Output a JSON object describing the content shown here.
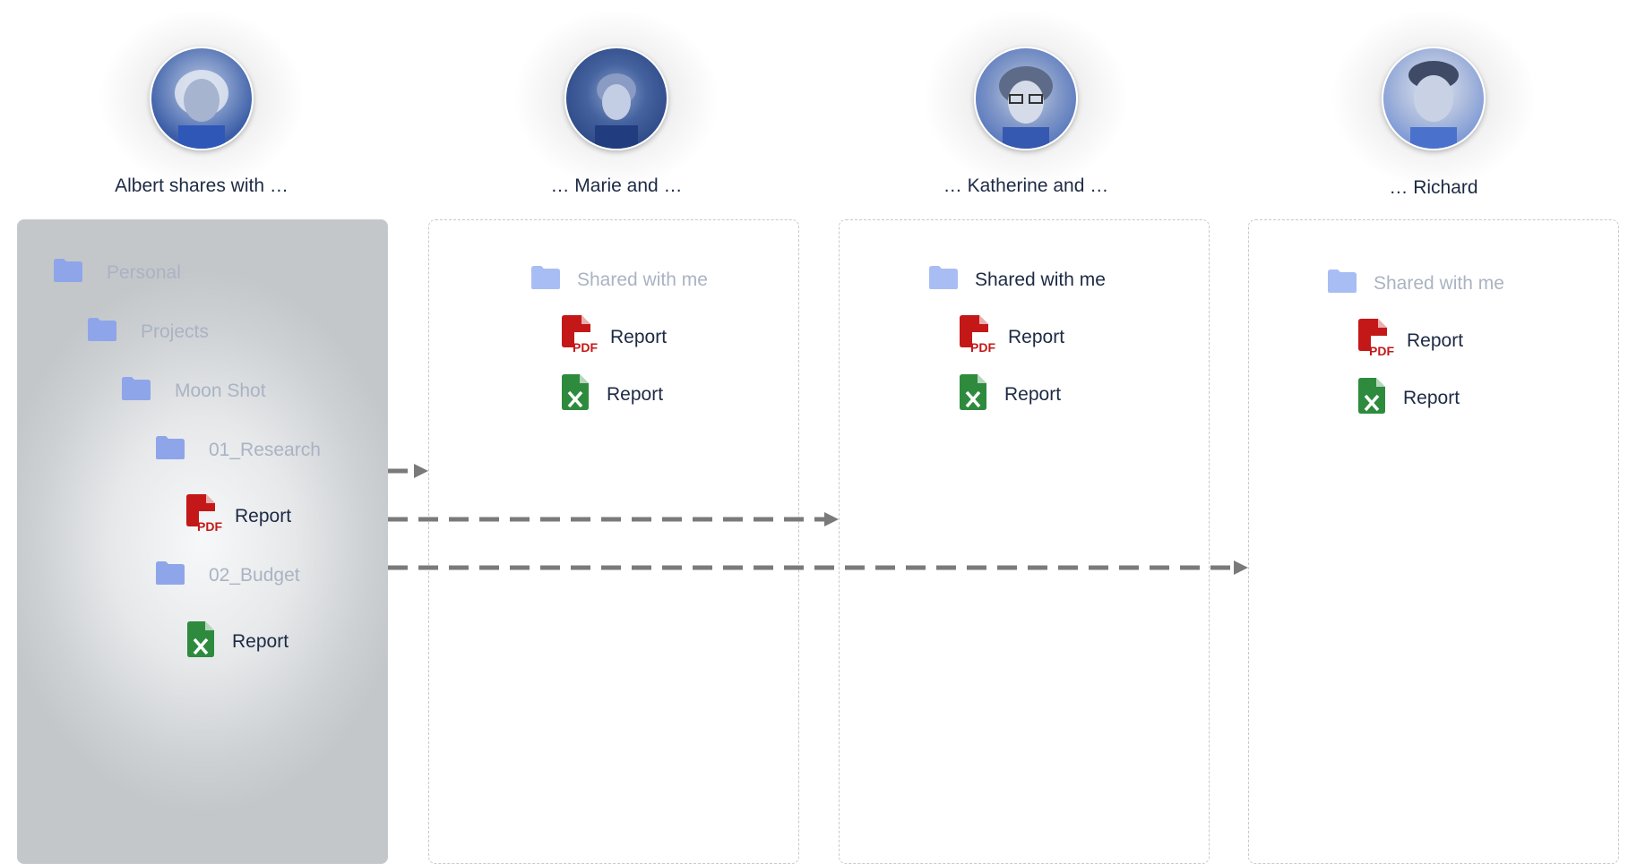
{
  "people": [
    {
      "name": "Albert",
      "caption": "Albert shares with …"
    },
    {
      "name": "Marie",
      "caption": "… Marie and …"
    },
    {
      "name": "Katherine",
      "caption": "… Katherine and …"
    },
    {
      "name": "Richard",
      "caption": "… Richard"
    }
  ],
  "source_tree": {
    "items": [
      {
        "label": "Personal",
        "type": "folder"
      },
      {
        "label": "Projects",
        "type": "folder"
      },
      {
        "label": "Moon Shot",
        "type": "folder"
      },
      {
        "label": "01_Research",
        "type": "folder"
      },
      {
        "label": "Report",
        "type": "pdf"
      },
      {
        "label": "02_Budget",
        "type": "folder"
      },
      {
        "label": "Report",
        "type": "xlsx"
      }
    ]
  },
  "recipients": [
    {
      "folder": "Shared with me",
      "files": [
        {
          "label": "Report",
          "type": "pdf"
        },
        {
          "label": "Report",
          "type": "xlsx"
        }
      ]
    },
    {
      "folder": "Shared with me",
      "files": [
        {
          "label": "Report",
          "type": "pdf"
        },
        {
          "label": "Report",
          "type": "xlsx"
        }
      ]
    },
    {
      "folder": "Shared with me",
      "files": [
        {
          "label": "Report",
          "type": "pdf"
        },
        {
          "label": "Report",
          "type": "xlsx"
        }
      ]
    }
  ],
  "icons": {
    "folder": "folder-icon",
    "pdf": "pdf-file-icon",
    "xlsx": "excel-file-icon"
  },
  "colors": {
    "folder": "#9fb3f0",
    "pdf": "#c41818",
    "xlsx": "#2e8b3e",
    "arrow": "#7a7a7a"
  }
}
